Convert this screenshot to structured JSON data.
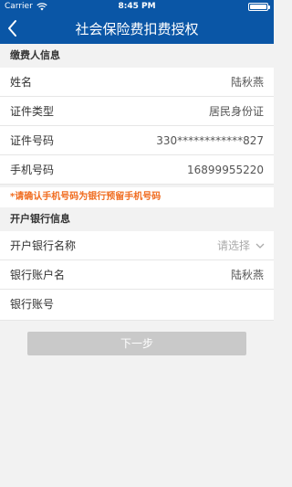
{
  "status_bar": {
    "carrier": "Carrier",
    "time": "8:45 PM"
  },
  "nav": {
    "title": "社会保险费扣费授权",
    "back_icon": "chevron-left-icon"
  },
  "payer_section": {
    "title": "缴费人信息",
    "rows": [
      {
        "label": "姓名",
        "value": "陆秋燕"
      },
      {
        "label": "证件类型",
        "value": "居民身份证"
      },
      {
        "label": "证件号码",
        "value": "330************827"
      },
      {
        "label": "手机号码",
        "value": "16899955220"
      }
    ],
    "warning": "*请确认手机号码为银行预留手机号码"
  },
  "bank_section": {
    "title": "开户银行信息",
    "bank_name_label": "开户银行名称",
    "bank_name_placeholder": "请选择",
    "account_name_label": "银行账户名",
    "account_name_value": "陆秋燕",
    "account_number_label": "银行账号",
    "account_number_value": ""
  },
  "next_button": "下一步",
  "colors": {
    "header_bg": "#0a56a6",
    "warning": "#f06c1f",
    "button_disabled": "#c9c9c9"
  }
}
